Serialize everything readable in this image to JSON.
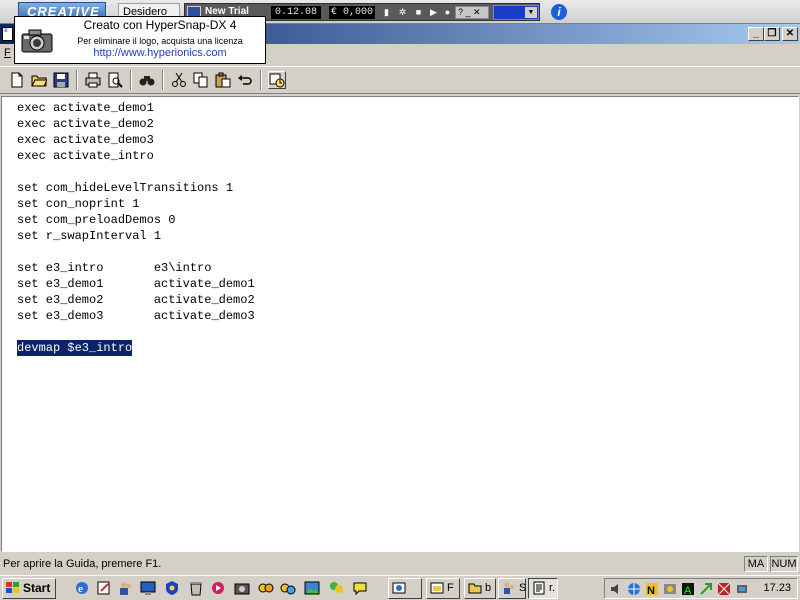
{
  "top_strip": {
    "brand_logo": "CREATIVE",
    "tab_label": "Desidero",
    "media_title": "New Trial",
    "timer": "0.12.08",
    "credit": "€ 0,000",
    "mini_box": "? _ ✕"
  },
  "watermark": {
    "line1": "Creato con HyperSnap-DX 4",
    "line2": "Per eliminare il logo, acquista una licenza",
    "line3": "http://www.hyperionics.com"
  },
  "window": {
    "minimize_glyph": "_",
    "restore_glyph": "❐",
    "close_glyph": "✕"
  },
  "menu": {
    "file_label": "F"
  },
  "toolbar": {
    "buttons": [
      "new-icon",
      "open-icon",
      "save-icon",
      "print-icon",
      "print-preview-icon",
      "find-icon",
      "cut-icon",
      "copy-icon",
      "paste-icon",
      "undo-icon",
      "insert-datetime-icon"
    ]
  },
  "editor": {
    "lines": [
      "exec activate_demo1",
      "exec activate_demo2",
      "exec activate_demo3",
      "exec activate_intro",
      "",
      "set com_hideLevelTransitions 1",
      "set con_noprint 1",
      "set com_preloadDemos 0",
      "set r_swapInterval 1",
      "",
      "set e3_intro       e3\\intro",
      "set e3_demo1       activate_demo1",
      "set e3_demo2       activate_demo2",
      "set e3_demo3       activate_demo3",
      "",
      "devmap $e3_intro"
    ],
    "selected_line_index": 15
  },
  "status": {
    "text": "Per aprire la Guida, premere F1.",
    "caps": "MA",
    "num": "NUM"
  },
  "taskbar": {
    "start_label": "Start",
    "tasks": [
      {
        "label": "",
        "icon": "explorer-icon"
      },
      {
        "label": "F",
        "icon": "folder-window-icon"
      },
      {
        "label": "b",
        "icon": "folder-icon"
      },
      {
        "label": "S",
        "icon": "people-icon"
      },
      {
        "label": "r.",
        "icon": "notepad-icon",
        "active": true
      }
    ],
    "clock": "17.23"
  },
  "colors": {
    "titlebar_start": "#0a246a",
    "selection": "#0a246a",
    "face": "#d4d0c8",
    "link": "#1c3fb8"
  }
}
